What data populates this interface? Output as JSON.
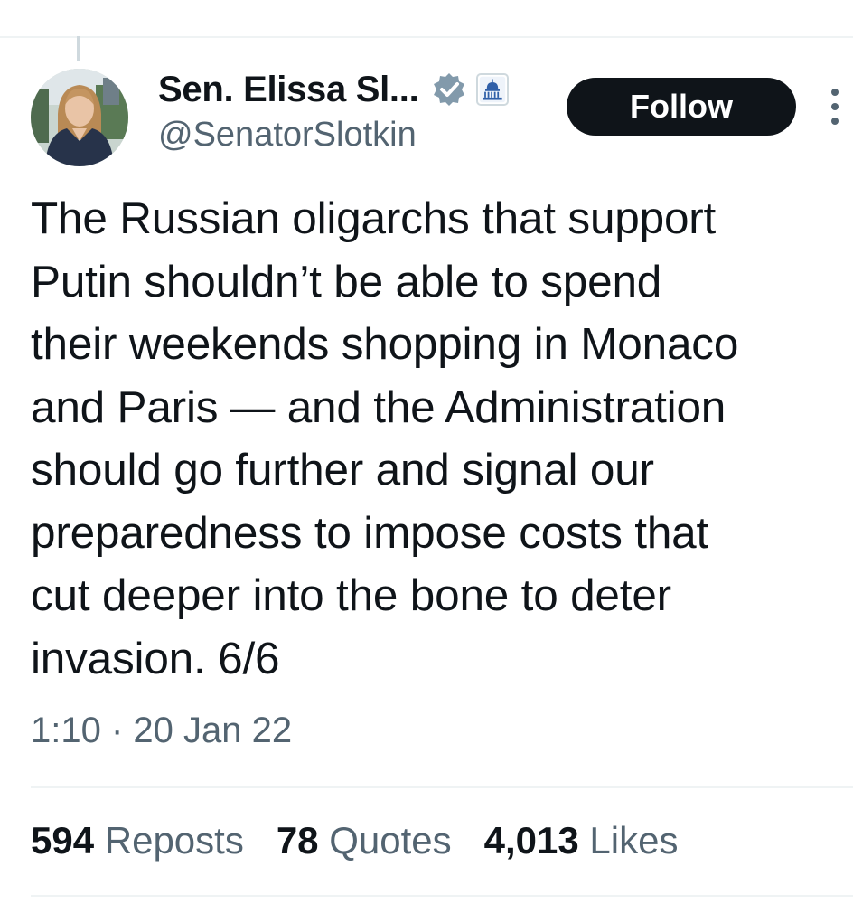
{
  "author": {
    "display_name": "Sen. Elissa Sl...",
    "handle": "@SenatorSlotkin",
    "avatar_icon": "profile-photo",
    "verified_icon": "verified-badge-icon",
    "affiliation_icon": "capitol-building-icon"
  },
  "follow_button": {
    "label": "Follow"
  },
  "more_icon": "more-vertical-icon",
  "tweet": {
    "text": "The Russian oligarchs that support\nPutin shouldn’t be able to spend\ntheir weekends shopping in Monaco\nand Paris — and the Administration\nshould go further and signal our\npreparedness to impose costs that\ncut deeper into the bone to deter\ninvasion. 6/6",
    "timestamp": "1:10 · 20 Jan 22"
  },
  "stats": [
    {
      "count": "594",
      "label": "Reposts"
    },
    {
      "count": "78",
      "label": "Quotes"
    },
    {
      "count": "4,013",
      "label": "Likes"
    }
  ],
  "colors": {
    "text": "#0f1419",
    "secondary": "#536471",
    "divider": "#eff3f4",
    "verified_badge": "#829aab",
    "follow_bg": "#0f1419"
  }
}
